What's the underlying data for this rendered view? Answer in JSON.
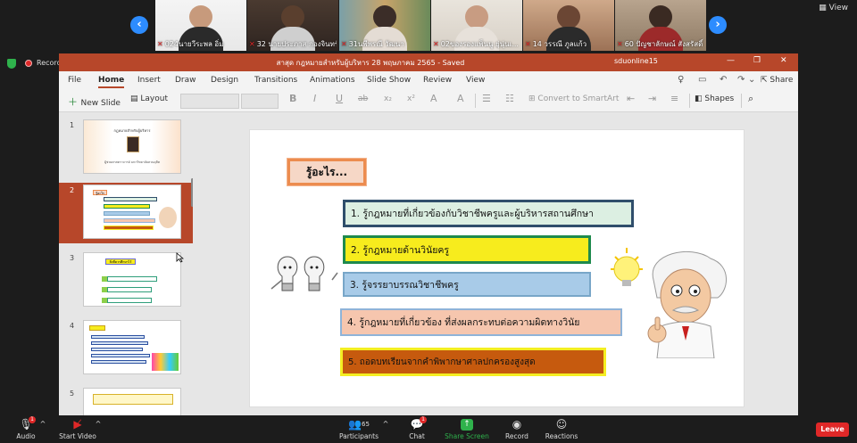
{
  "zoom": {
    "view_label": "View",
    "recording_label": "Recording",
    "participants": [
      {
        "name": "024นายวีระพล อิ่ม"
      },
      {
        "name": "32 นายประภาส กองจินทร์"
      },
      {
        "name": "31นพีพรณี วัฒนา"
      },
      {
        "name": "02ของรองแพ็นนู ยุ่นุ่นเ..."
      },
      {
        "name": "14 วรรณี ภูลแก้ว"
      },
      {
        "name": "60 ปัญชาลักษณ์ สังสรัสดิ์"
      }
    ],
    "controls": {
      "audio": "Audio",
      "start_video": "Start Video",
      "participants": "Participants",
      "participants_count": "65",
      "chat": "Chat",
      "chat_badge": "1",
      "audio_badge": "1",
      "share_screen": "Share Screen",
      "record": "Record",
      "reactions": "Reactions",
      "leave": "Leave"
    }
  },
  "ppt": {
    "title": "สาสุด กฎหมายสำหรับผู้บริหาร 28 พฤษภาคม 2565  -  Saved",
    "user": "sduonline15",
    "tabs": [
      "File",
      "Home",
      "Insert",
      "Draw",
      "Design",
      "Transitions",
      "Animations",
      "Slide Show",
      "Review",
      "View"
    ],
    "share_label": "Share",
    "toolbar": {
      "new_slide": "New Slide",
      "layout": "Layout",
      "bold": "B",
      "italic": "I",
      "underline": "U",
      "strike": "ab",
      "subscript": "x₂",
      "superscript": "x²",
      "convert_smartart": "Convert to SmartArt",
      "shapes": "Shapes"
    },
    "thumbnails": [
      {
        "num": "1",
        "title": "กฎหมายสำหรับผู้บริหาร",
        "subtitle": "ผู้ช่วยศาสตราจารย์ มหาวิทยาลัยสวนดุสิต"
      },
      {
        "num": "2",
        "title": "รู้อะไร"
      },
      {
        "num": "3",
        "title": "สิ่งที่ควรศึกษาไว้"
      },
      {
        "num": "4",
        "title": ""
      },
      {
        "num": "5",
        "title": ""
      }
    ],
    "slide": {
      "heading": "รู้อะไร...",
      "items": [
        "1. รู้กฎหมายที่เกี่ยวข้องกับวิชาชีพครูและผู้บริหารสถานศึกษา",
        "2. รู้กฎหมายด้านวินัยครู",
        "3. รู้จรรยาบรรณวิชาชีพครู",
        "4. รู้กฎหมายที่เกี่ยวข้อง ที่ส่งผลกระทบต่อความผิดทางวินัย",
        "5. ถอดบทเรียนจากคำพิพากษาศาลปกครองสูงสุด"
      ]
    }
  }
}
